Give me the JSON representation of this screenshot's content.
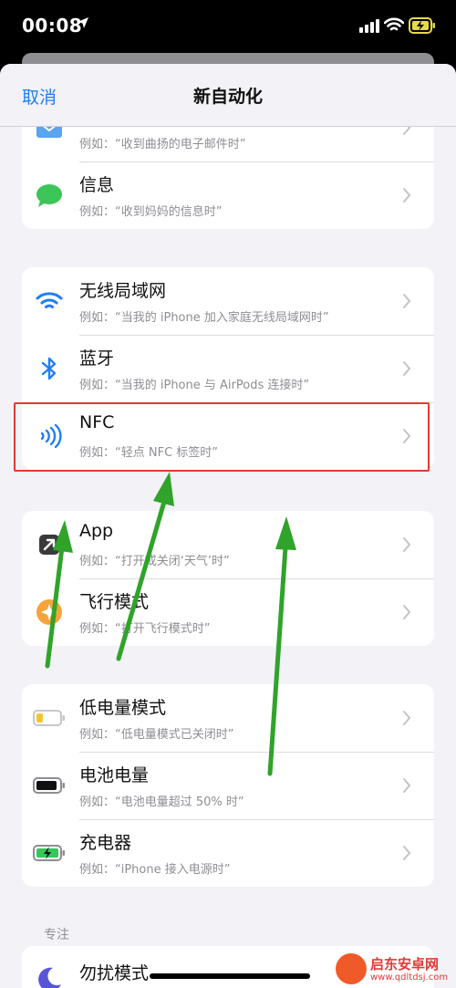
{
  "status_bar": {
    "time": "00:08",
    "icons": [
      "location-arrow-icon",
      "cellular-signal-icon",
      "wifi-icon",
      "battery-charging-icon"
    ]
  },
  "nav": {
    "cancel_label": "取消",
    "title": "新自动化"
  },
  "groups": [
    {
      "items": [
        {
          "title": "",
          "subtitle": "例如：“收到曲扬的电子邮件时”",
          "icon": "mail-icon"
        },
        {
          "title": "信息",
          "subtitle": "例如：“收到妈妈的信息时”",
          "icon": "messages-icon"
        }
      ]
    },
    {
      "items": [
        {
          "title": "无线局域网",
          "subtitle": "例如：“当我的 iPhone 加入家庭无线局域网时”",
          "icon": "wifi-icon"
        },
        {
          "title": "蓝牙",
          "subtitle": "例如：“当我的 iPhone 与 AirPods 连接时”",
          "icon": "bluetooth-icon"
        },
        {
          "title": "NFC",
          "subtitle": "例如：“轻点 NFC 标签时”",
          "icon": "nfc-icon"
        }
      ]
    },
    {
      "items": [
        {
          "title": "App",
          "subtitle": "例如：“打开或关闭‘天气’时”",
          "icon": "app-icon"
        },
        {
          "title": "飞行模式",
          "subtitle": "例如：“打开飞行模式时”",
          "icon": "airplane-mode-icon"
        }
      ]
    },
    {
      "items": [
        {
          "title": "低电量模式",
          "subtitle": "例如：“低电量模式已关闭时”",
          "icon": "low-battery-icon"
        },
        {
          "title": "电池电量",
          "subtitle": "例如：“电池电量超过 50% 时”",
          "icon": "battery-level-icon"
        },
        {
          "title": "充电器",
          "subtitle": "例如：“iPhone 接入电源时”",
          "icon": "charger-icon"
        }
      ]
    }
  ],
  "section_focus": {
    "header": "专注",
    "items": [
      {
        "title": "勿扰模式",
        "icon": "moon-icon"
      }
    ]
  },
  "watermark": {
    "title": "启东安卓网",
    "url": "www.qdltdsj.com"
  },
  "colors": {
    "accent": "#1f7ef6",
    "highlight": "#e53935",
    "arrow": "#2fa32a",
    "background": "#f2f2f7"
  }
}
